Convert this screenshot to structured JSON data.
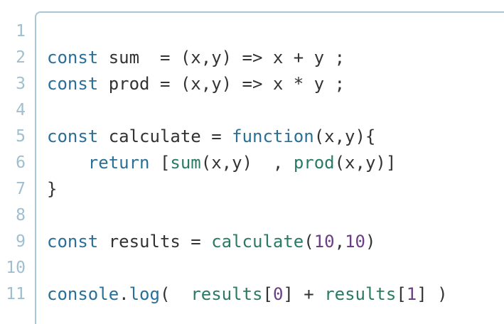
{
  "editor": {
    "line_numbers": [
      "1",
      "2",
      "3",
      "4",
      "5",
      "6",
      "7",
      "8",
      "9",
      "10",
      "11"
    ],
    "lines": [
      [],
      [
        {
          "t": "const",
          "c": "kw"
        },
        {
          "t": " sum  = (x,y) => x + y ;",
          "c": "plain"
        }
      ],
      [
        {
          "t": "const",
          "c": "kw"
        },
        {
          "t": " prod = (x,y) => x * y ;",
          "c": "plain"
        }
      ],
      [],
      [
        {
          "t": "const",
          "c": "kw"
        },
        {
          "t": " calculate = ",
          "c": "plain"
        },
        {
          "t": "function",
          "c": "kw"
        },
        {
          "t": "(x,y){",
          "c": "plain"
        }
      ],
      [
        {
          "t": "    ",
          "c": "plain"
        },
        {
          "t": "return",
          "c": "kw"
        },
        {
          "t": " [",
          "c": "plain"
        },
        {
          "t": "sum",
          "c": "fn"
        },
        {
          "t": "(x,y)  , ",
          "c": "plain"
        },
        {
          "t": "prod",
          "c": "fn"
        },
        {
          "t": "(x,y)]",
          "c": "plain"
        }
      ],
      [
        {
          "t": "}",
          "c": "plain"
        }
      ],
      [],
      [
        {
          "t": "const",
          "c": "kw"
        },
        {
          "t": " results = ",
          "c": "plain"
        },
        {
          "t": "calculate",
          "c": "fn"
        },
        {
          "t": "(",
          "c": "plain"
        },
        {
          "t": "10",
          "c": "num"
        },
        {
          "t": ",",
          "c": "plain"
        },
        {
          "t": "10",
          "c": "num"
        },
        {
          "t": ")",
          "c": "plain"
        }
      ],
      [],
      [
        {
          "t": "console",
          "c": "kw"
        },
        {
          "t": ".",
          "c": "plain"
        },
        {
          "t": "log",
          "c": "kw"
        },
        {
          "t": "(  ",
          "c": "plain"
        },
        {
          "t": "results",
          "c": "fn"
        },
        {
          "t": "[",
          "c": "plain"
        },
        {
          "t": "0",
          "c": "num"
        },
        {
          "t": "] + ",
          "c": "plain"
        },
        {
          "t": "results",
          "c": "fn"
        },
        {
          "t": "[",
          "c": "plain"
        },
        {
          "t": "1",
          "c": "num"
        },
        {
          "t": "] )",
          "c": "plain"
        }
      ]
    ]
  },
  "colors": {
    "keyword": "#2a6f97",
    "function": "#2a7a64",
    "number": "#6b3f86",
    "plain": "#333333",
    "gutter": "#9fbfd0",
    "border": "#a9c6d6"
  }
}
